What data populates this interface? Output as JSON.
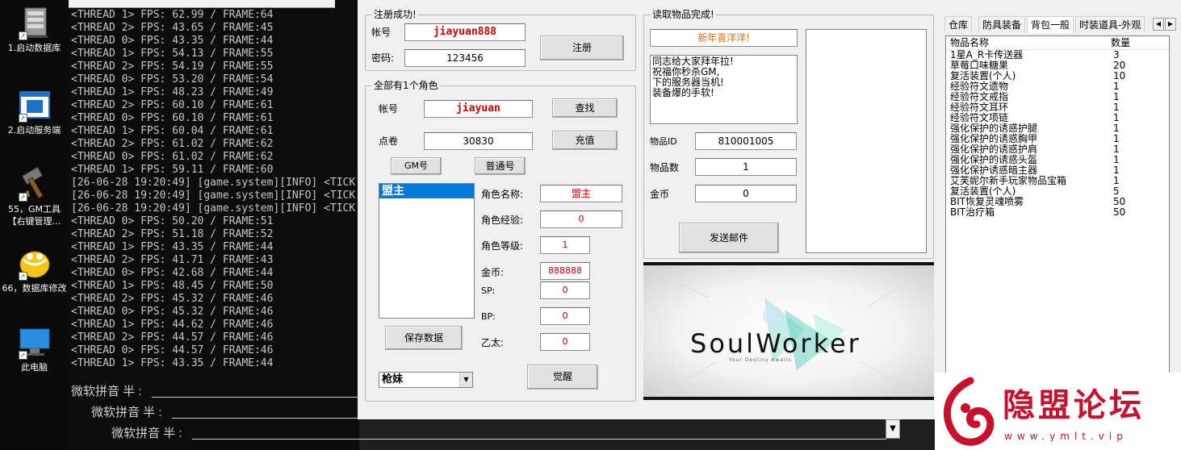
{
  "desktop": {
    "icons": [
      {
        "label": "1.启动数据库",
        "icon": "server-icon"
      },
      {
        "label": "2.启动服务端",
        "icon": "window-app-icon"
      },
      {
        "label": "55，GM工具【右键管理…",
        "icon": "hammer-icon"
      },
      {
        "label": "66，数据库修改",
        "icon": "database-icon"
      },
      {
        "label": "此电脑",
        "icon": "computer-icon"
      }
    ]
  },
  "console": {
    "lines": [
      "<THREAD 1> FPS: 62.99 / FRAME:64",
      "<THREAD 2> FPS: 43.65 / FRAME:45",
      "<THREAD 0> FPS: 43.35 / FRAME:44",
      "<THREAD 1> FPS: 54.13 / FRAME:55",
      "<THREAD 2> FPS: 54.19 / FRAME:55",
      "<THREAD 0> FPS: 53.20 / FRAME:54",
      "<THREAD 1> FPS: 48.23 / FRAME:49",
      "<THREAD 2> FPS: 60.10 / FRAME:61",
      "<THREAD 0> FPS: 60.10 / FRAME:61",
      "<THREAD 1> FPS: 60.04 / FRAME:61",
      "<THREAD 2> FPS: 61.02 / FRAME:62",
      "<THREAD 0> FPS: 61.02 / FRAME:62",
      "<THREAD 1> FPS: 59.11 / FRAME:60",
      "[26-06-28 19:20:49] [game.system][INFO] <TICK",
      "[26-06-28 19:20:49] [game.system][INFO] <TICK",
      "[26-06-28 19:20:49] [game.system][INFO] <TICK",
      "<THREAD 0> FPS: 50.20 / FRAME:51",
      "<THREAD 2> FPS: 51.18 / FRAME:52",
      "<THREAD 1> FPS: 43.35 / FRAME:44",
      "<THREAD 2> FPS: 41.71 / FRAME:43",
      "<THREAD 0> FPS: 42.68 / FRAME:44",
      "<THREAD 1> FPS: 48.45 / FRAME:50",
      "<THREAD 2> FPS: 45.32 / FRAME:46",
      "<THREAD 0> FPS: 45.32 / FRAME:46",
      "<THREAD 1> FPS: 44.62 / FRAME:46",
      "<THREAD 2> FPS: 44.57 / FRAME:46",
      "<THREAD 0> FPS: 44.57 / FRAME:46",
      "<THREAD 1> FPS: 43.35 / FRAME:44"
    ],
    "ime": [
      "微软拼音 半 :",
      "微软拼音 半 :",
      "微软拼音 半 :"
    ]
  },
  "register": {
    "title": "注册成功!",
    "account_label": "帐号",
    "account_value": "jiayuan888",
    "password_label": "密码:",
    "password_value": "123456",
    "register_button": "注册"
  },
  "role": {
    "title": "全部有1个角色",
    "account_label": "帐号",
    "account_value": "jiayuan",
    "search_button": "查找",
    "points_label": "点卷",
    "points_value": "30830",
    "recharge_button": "充值",
    "gm_button": "GM号",
    "normal_button": "普通号",
    "role_list": [
      "盟主"
    ],
    "name_label": "角色名称:",
    "name_value": "盟主",
    "exp_label": "角色经验:",
    "exp_value": "0",
    "level_label": "角色等级:",
    "level_value": "1",
    "gold_label": "金币:",
    "gold_value": "888888",
    "sp_label": "SP:",
    "sp_value": "0",
    "bp_label": "BP:",
    "bp_value": "0",
    "ether_label": "乙太:",
    "ether_value": "0",
    "save_button": "保存数据",
    "class_select": "枪妹",
    "awaken_button": "觉醒"
  },
  "mail": {
    "title": "读取物品完成!",
    "subject_value": "新年喜洋洋!",
    "body_value": "同志给大家拜年拉!\n祝福你秒杀GM,\n下的服务器当机!\n装备爆的手软!",
    "item_id_label": "物品ID",
    "item_id_value": "810001005",
    "item_count_label": "物品数",
    "item_count_value": "1",
    "gold_label": "金币",
    "gold_value": "0",
    "send_button": "发送邮件"
  },
  "banner": {
    "logo_text": "SoulWorker",
    "subtitle": "Your Destiny Awaits"
  },
  "tabs": [
    "仓库",
    "防具装备",
    "背包一般",
    "时装道具-外观"
  ],
  "active_tab": 2,
  "inventory": {
    "headers": [
      "物品名称",
      "数量"
    ],
    "rows": [
      [
        "1星A_R卡传送器",
        "3"
      ],
      [
        "草莓口味糖果",
        "20"
      ],
      [
        "复活装置(个人)",
        "10"
      ],
      [
        "经验符文遗物",
        "1"
      ],
      [
        "经验符文戒指",
        "1"
      ],
      [
        "经验符文耳环",
        "1"
      ],
      [
        "经验符文项链",
        "1"
      ],
      [
        "强化保护的诱惑护腿",
        "1"
      ],
      [
        "强化保护的诱惑胸甲",
        "1"
      ],
      [
        "强化保护的诱惑护肩",
        "1"
      ],
      [
        "强化保护的诱惑头盔",
        "1"
      ],
      [
        "强化保护诱惑暗主器",
        "1"
      ],
      [
        "艾芙妮尔新手玩家物品宝箱",
        "1"
      ],
      [
        "复活装置(个人)",
        "5"
      ],
      [
        "BIT恢复灵魂喷雾",
        "50"
      ],
      [
        "BIT治疗箱",
        "50"
      ]
    ]
  },
  "watermark": {
    "name": "隐盟论坛",
    "url": "www.ymlt.vip"
  },
  "colors": {
    "accent": "#0078d7",
    "red": "#cc0000",
    "brand": "#c8102e"
  }
}
